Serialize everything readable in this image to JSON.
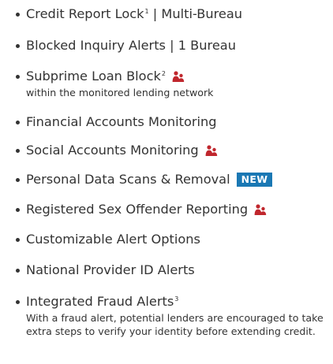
{
  "features": [
    {
      "label": "Credit Report Lock",
      "sup": "1",
      "suffix": " | Multi-Bureau"
    },
    {
      "label": "Blocked Inquiry Alerts | 1 Bureau"
    },
    {
      "label": "Subprime Loan Block",
      "sup": "2",
      "icon": "family-icon",
      "sub": "within the monitored lending network"
    },
    {
      "label": "Financial Accounts Monitoring"
    },
    {
      "label": "Social Accounts Monitoring",
      "icon": "family-icon"
    },
    {
      "label": "Personal Data Scans & Removal",
      "badge": "NEW"
    },
    {
      "label": "Registered Sex Offender Reporting",
      "icon": "family-icon"
    },
    {
      "label": "Customizable Alert Options"
    },
    {
      "label": "National Provider ID Alerts"
    },
    {
      "label": "Integrated Fraud Alerts",
      "sup": "3",
      "sub": "With a fraud alert, potential lenders are encouraged to take extra steps to verify your identity before extending credit."
    }
  ],
  "colors": {
    "text": "#333333",
    "badge_bg": "#1a78b4",
    "icon": "#c0272d"
  }
}
